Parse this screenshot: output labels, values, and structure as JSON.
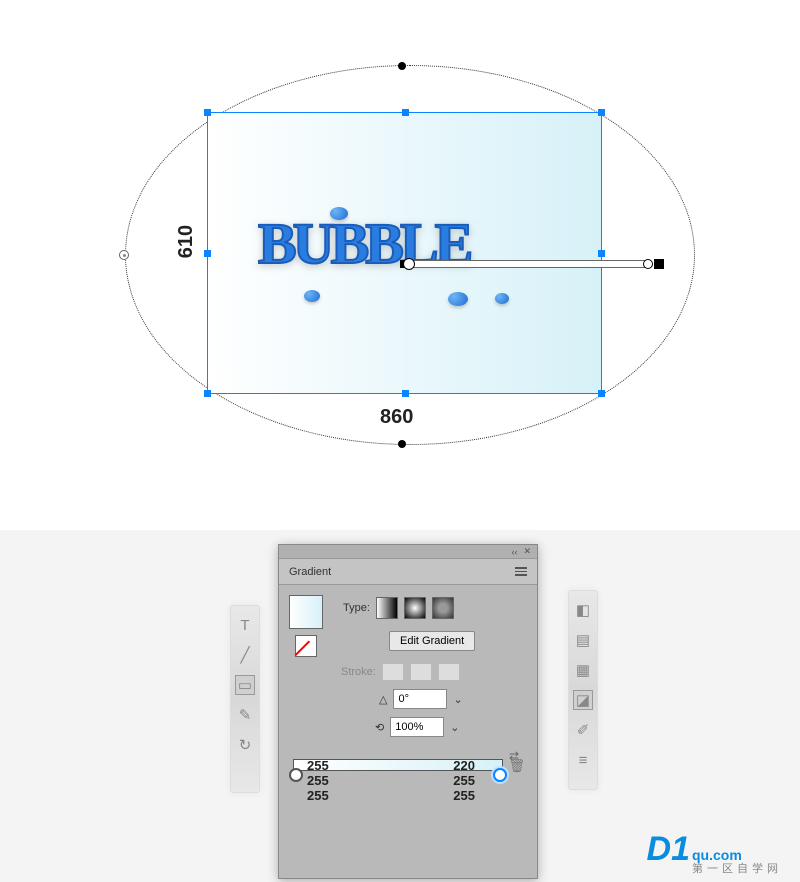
{
  "canvas": {
    "dimensions": {
      "width_label": "860",
      "height_label": "610"
    },
    "artwork_text": "BUBBLE"
  },
  "gradient_panel": {
    "title": "Gradient",
    "type_label": "Type:",
    "edit_button": "Edit Gradient",
    "stroke_label": "Stroke:",
    "angle_value": "0°",
    "aspect_value": "100%",
    "stops": {
      "left": {
        "r": "255",
        "g": "255",
        "b": "255"
      },
      "right": {
        "r": "220",
        "g": "255",
        "b": "255"
      }
    }
  },
  "watermark": {
    "brand": "D1",
    "domain": "qu.com",
    "subtitle": "第一区自学网"
  }
}
